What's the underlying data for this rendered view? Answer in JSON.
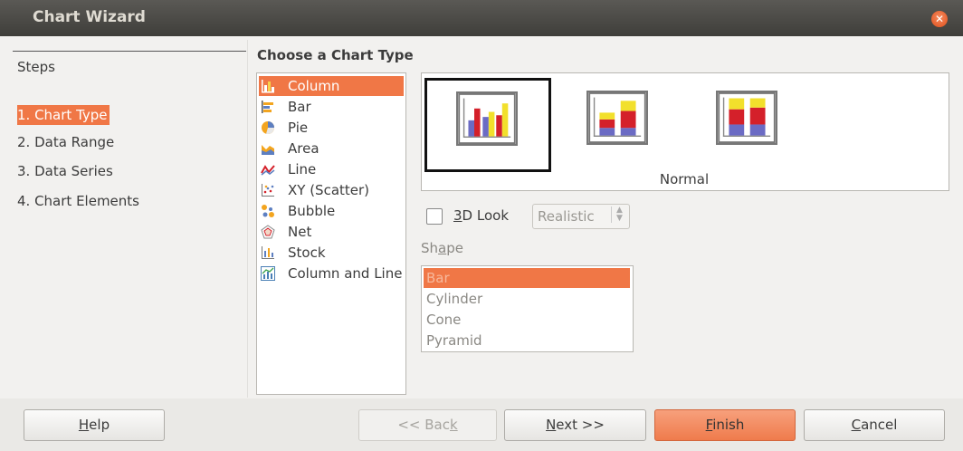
{
  "window": {
    "title": "Chart Wizard"
  },
  "steps": {
    "title": "Steps",
    "items": [
      {
        "label": "1. Chart Type",
        "selected": true
      },
      {
        "label": "2. Data Range"
      },
      {
        "label": "3. Data Series"
      },
      {
        "label": "4. Chart Elements"
      }
    ]
  },
  "chart_types": {
    "title": "Choose a Chart Type",
    "items": [
      {
        "label": "Column",
        "icon": "column-chart-icon"
      },
      {
        "label": "Bar",
        "icon": "bar-chart-icon"
      },
      {
        "label": "Pie",
        "icon": "pie-chart-icon"
      },
      {
        "label": "Area",
        "icon": "area-chart-icon"
      },
      {
        "label": "Line",
        "icon": "line-chart-icon"
      },
      {
        "label": "XY (Scatter)",
        "icon": "scatter-chart-icon"
      },
      {
        "label": "Bubble",
        "icon": "bubble-chart-icon"
      },
      {
        "label": "Net",
        "icon": "net-chart-icon"
      },
      {
        "label": "Stock",
        "icon": "stock-chart-icon"
      },
      {
        "label": "Column and Line",
        "icon": "column-line-chart-icon"
      }
    ],
    "selected": "Column"
  },
  "variants": {
    "selected_name": "Normal",
    "items": [
      "normal",
      "stacked",
      "percent-stacked"
    ]
  },
  "options": {
    "look3d_label": "3D Look",
    "look3d_checked": false,
    "look_style": "Realistic",
    "shape_title": "Shape",
    "shapes": [
      "Bar",
      "Cylinder",
      "Cone",
      "Pyramid"
    ],
    "shape_selected": "Bar"
  },
  "buttons": {
    "help": "Help",
    "back": "<< Back",
    "next": "Next >>",
    "finish": "Finish",
    "cancel": "Cancel"
  },
  "colors": {
    "accent": "#f07746",
    "titlebar": "#3f3e3a",
    "bar_blue": "#6b6bc4",
    "bar_red": "#d4202a",
    "bar_yellow": "#f2e02c"
  }
}
